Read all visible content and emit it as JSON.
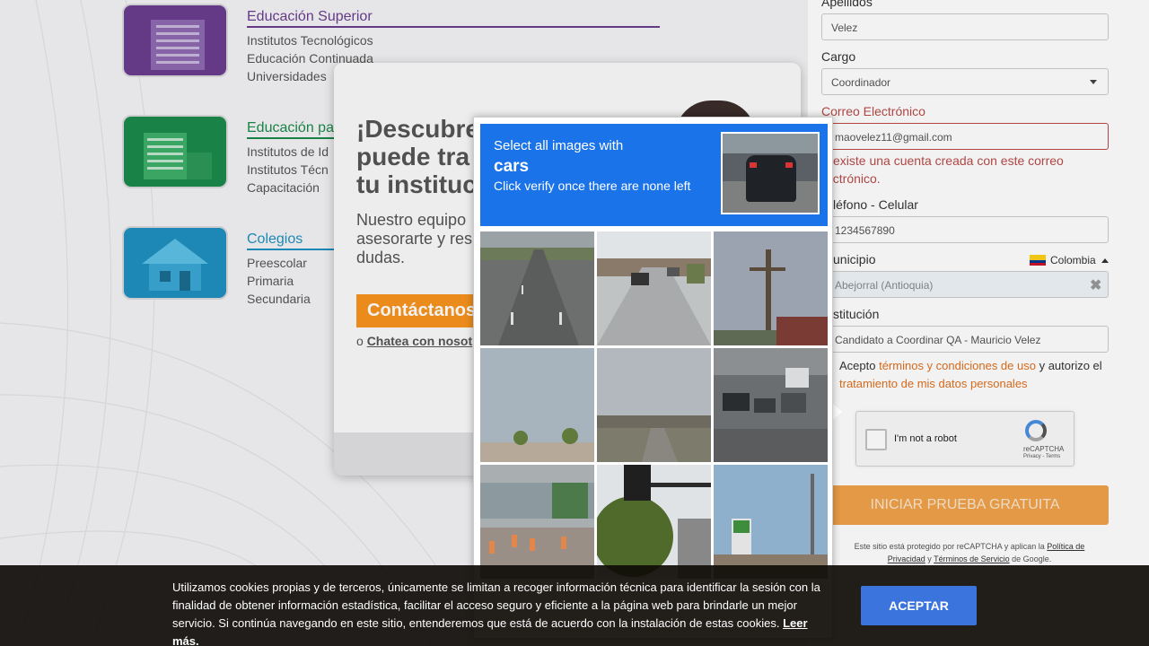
{
  "segments": [
    {
      "title": "Educación Superior",
      "color": "#6a3e8e",
      "items": [
        "Institutos Tecnológicos",
        "Educación Continuada",
        "Universidades"
      ]
    },
    {
      "title": "Educación pa",
      "color": "#1b8a4a",
      "items": [
        "Institutos de Id",
        "Institutos Técn",
        "Capacitación"
      ]
    },
    {
      "title": "Colegios",
      "color": "#1f8fbf",
      "items": [
        "Preescolar",
        "Primaria",
        "Secundaria"
      ]
    }
  ],
  "promo": {
    "headline": [
      "¡Descubre",
      "puede tra",
      "tu instituc"
    ],
    "subtext": [
      "Nuestro equipo",
      "asesorarte y resp",
      "dudas."
    ],
    "cta": "Contáctanos",
    "chat_prefix": "o",
    "chat_link": "Chatea con nosot"
  },
  "form": {
    "apellidos_label": "Apellidos",
    "apellidos_value": "Velez",
    "cargo_label": "Cargo",
    "cargo_value": "Coordinador",
    "email_label": "Correo Electrónico",
    "email_value": "maovelez11@gmail.com",
    "email_error": [
      "existe una cuenta creada con este correo",
      "ectrónico."
    ],
    "phone_label": "léfono - Celular",
    "phone_value": "1234567890",
    "municipio_label": "unicipio",
    "country": "Colombia",
    "municipio_value": "Abejorral (Antioquia)",
    "institucion_label": "stitución",
    "institucion_value": "Candidato a Coordinar QA - Mauricio Velez",
    "terms_prefix": "Acepto ",
    "terms_link": "términos y condiciones de uso",
    "terms_mid": " y autorizo el",
    "data_link": "tratamiento de mis datos personales",
    "submit": "INICIAR PRUEBA GRATUITA",
    "protect_a": "Este sitio está protegido por reCAPTCHA y aplican la ",
    "protect_privacy": "Política de Privacidad",
    "protect_and": " y ",
    "protect_terms": "Términos de Servicio",
    "protect_end": " de Google."
  },
  "recaptcha_widget": {
    "label": "I'm not a robot",
    "brand": "reCAPTCHA",
    "links": "Privacy - Terms"
  },
  "captcha": {
    "line1": "Select all images with",
    "target": "cars",
    "line3": "Click verify once there are none left",
    "tiles": [
      "road-lanes",
      "street-cars",
      "utility-pole",
      "sky-bushes",
      "overpass",
      "wet-road-traffic",
      "construction-signs",
      "traffic-light-tree",
      "gas-station-pole"
    ]
  },
  "cookie": {
    "text": "Utilizamos cookies propias y de terceros, únicamente se limitan a recoger información técnica para identificar la sesión con la finalidad de obtener información estadística, facilitar el acceso seguro y eficiente a la página web para brindarle un mejor servicio. Si continúa navegando en este sitio, entenderemos que está de acuerdo con la instalación de estas cookies.",
    "more": "Leer más.",
    "accept": "ACEPTAR"
  }
}
